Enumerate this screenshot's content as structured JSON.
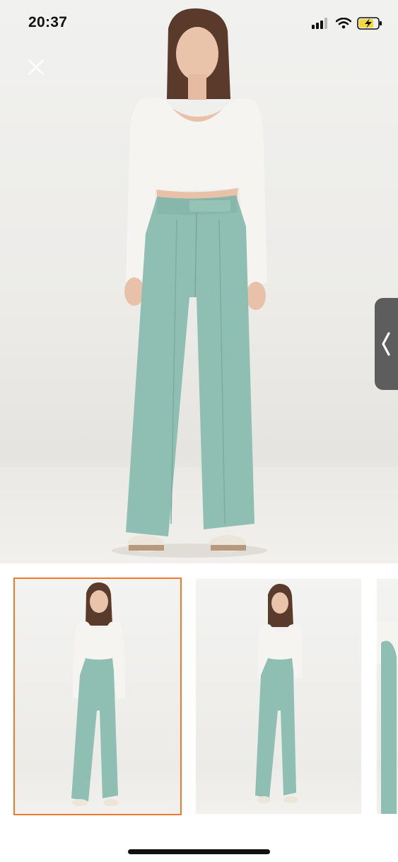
{
  "status_bar": {
    "time": "20:37",
    "icons": [
      "signal-icon",
      "wifi-icon",
      "battery-charging-icon"
    ],
    "battery_color": "#f4d93a"
  },
  "viewer": {
    "close_icon": "close-icon",
    "side_handle_icon": "chevron-left-icon",
    "thumbnail_count_visible": 3,
    "selected_thumbnail_index": 0,
    "selected_border_color": "#f07a2a"
  },
  "product": {
    "top_color": "#f5f4f0",
    "pants_color": "#8fbfb2",
    "shoe_color": "#ece5d9"
  }
}
